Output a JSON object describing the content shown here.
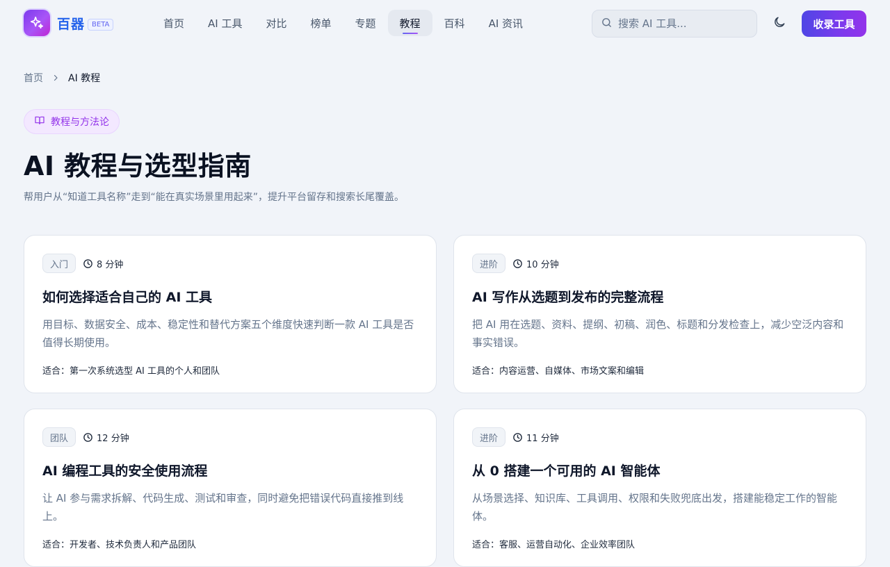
{
  "brand": {
    "name": "百器",
    "badge": "BETA"
  },
  "nav": [
    {
      "label": "首页",
      "active": false
    },
    {
      "label": "AI 工具",
      "active": false
    },
    {
      "label": "对比",
      "active": false
    },
    {
      "label": "榜单",
      "active": false
    },
    {
      "label": "专题",
      "active": false
    },
    {
      "label": "教程",
      "active": true
    },
    {
      "label": "百科",
      "active": false
    },
    {
      "label": "AI 资讯",
      "active": false
    }
  ],
  "search": {
    "placeholder": "搜索 AI 工具..."
  },
  "actions": {
    "submit_label": "收录工具"
  },
  "breadcrumb": {
    "home": "首页",
    "current": "AI 教程"
  },
  "hero": {
    "pill": "教程与方法论",
    "title": "AI 教程与选型指南",
    "subtitle": "帮用户从“知道工具名称”走到“能在真实场景里用起来”，提升平台留存和搜索长尾覆盖。"
  },
  "cards": [
    {
      "level": "入门",
      "duration": "8 分钟",
      "title": "如何选择适合自己的 AI 工具",
      "desc": "用目标、数据安全、成本、稳定性和替代方案五个维度快速判断一款 AI 工具是否值得长期使用。",
      "audience": "适合：第一次系统选型 AI 工具的个人和团队"
    },
    {
      "level": "进阶",
      "duration": "10 分钟",
      "title": "AI 写作从选题到发布的完整流程",
      "desc": "把 AI 用在选题、资料、提纲、初稿、润色、标题和分发检查上，减少空泛内容和事实错误。",
      "audience": "适合：内容运营、自媒体、市场文案和编辑"
    },
    {
      "level": "团队",
      "duration": "12 分钟",
      "title": "AI 编程工具的安全使用流程",
      "desc": "让 AI 参与需求拆解、代码生成、测试和审查，同时避免把错误代码直接推到线上。",
      "audience": "适合：开发者、技术负责人和产品团队"
    },
    {
      "level": "进阶",
      "duration": "11 分钟",
      "title": "从 0 搭建一个可用的 AI 智能体",
      "desc": "从场景选择、知识库、工具调用、权限和失败兜底出发，搭建能稳定工作的智能体。",
      "audience": "适合：客服、运营自动化、企业效率团队"
    }
  ],
  "colors": {
    "accent": "#7c3aed",
    "brand_text": "#2563eb",
    "pill_text": "#9333ea"
  }
}
